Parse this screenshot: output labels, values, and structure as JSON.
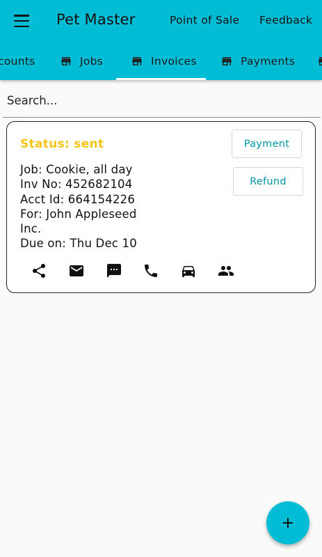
{
  "app": {
    "title": "Pet Master",
    "actions": [
      "Point of Sale",
      "Feedback"
    ]
  },
  "tabs": [
    {
      "label": "Accounts",
      "visible_label": "counts",
      "active": false
    },
    {
      "label": "Jobs",
      "active": false
    },
    {
      "label": "Invoices",
      "active": true
    },
    {
      "label": "Payments",
      "active": false
    }
  ],
  "search": {
    "placeholder": "Search..."
  },
  "invoice": {
    "status": "Status: sent",
    "lines": [
      "Job: Cookie, all day",
      "Inv No: 452682104",
      "Acct Id: 664154226",
      "For: John Appleseed",
      "Inc.",
      "Due on: Thu Dec 10"
    ],
    "buttons": {
      "payment": "Payment",
      "refund": "Refund"
    },
    "action_icons": [
      "share-icon",
      "email-icon",
      "message-icon",
      "phone-icon",
      "car-icon",
      "people-icon"
    ]
  },
  "fab": {
    "icon": "add-icon"
  },
  "colors": {
    "primary": "#00bcd4",
    "status_sent": "#f5c518",
    "button_text": "#0097a7"
  }
}
